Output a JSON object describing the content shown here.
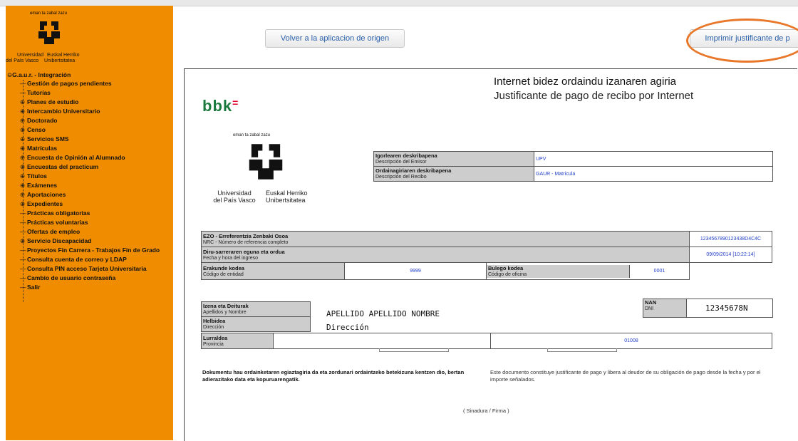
{
  "sidebar": {
    "logo_motto": "eman ta zabal zazu",
    "logo_univ_es": "Universidad\ndel País Vasco",
    "logo_univ_eu": "Euskal Herriko\nUnibertsitatea",
    "root": "G.a.u.r. - Integración",
    "items": [
      {
        "prefix": "—",
        "label": "Gestión de pagos pendientes"
      },
      {
        "prefix": "—",
        "label": "Tutorías"
      },
      {
        "prefix": "⊕",
        "label": "Planes de estudio"
      },
      {
        "prefix": "⊕",
        "label": "Intercambio Universitario"
      },
      {
        "prefix": "⊕",
        "label": "Doctorado"
      },
      {
        "prefix": "⊕",
        "label": "Censo"
      },
      {
        "prefix": "⊕",
        "label": "Servicios SMS"
      },
      {
        "prefix": "⊕",
        "label": "Matrículas"
      },
      {
        "prefix": "⊕",
        "label": "Encuesta de Opinión al Alumnado"
      },
      {
        "prefix": "⊕",
        "label": "Encuestas del practicum"
      },
      {
        "prefix": "⊕",
        "label": "Títulos"
      },
      {
        "prefix": "⊕",
        "label": "Exámenes"
      },
      {
        "prefix": "⊕",
        "label": "Aportaciones"
      },
      {
        "prefix": "⊕",
        "label": "Expedientes"
      },
      {
        "prefix": "—",
        "label": "Prácticas obligatorias"
      },
      {
        "prefix": "—",
        "label": "Prácticas voluntarias"
      },
      {
        "prefix": "—",
        "label": "Ofertas de empleo"
      },
      {
        "prefix": "⊕",
        "label": "Servicio Discapacidad"
      },
      {
        "prefix": "—",
        "label": "Proyectos Fin Carrera - Trabajos Fin de Grado"
      },
      {
        "prefix": "—",
        "label": "Consulta cuenta de correo y LDAP"
      },
      {
        "prefix": "—",
        "label": "Consulta PIN acceso Tarjeta Universitaria"
      },
      {
        "prefix": "—",
        "label": "Cambio de usuario contraseña"
      },
      {
        "prefix": "—",
        "label": "Salir"
      }
    ]
  },
  "toolbar": {
    "back_label": "Volver a la aplicacion de origen",
    "print_label": "Imprimir justificante de p"
  },
  "doc": {
    "bank": "bbk",
    "title_eu": "Internet bidez ordaindu izanaren agiria",
    "title_es": "Justificante de pago de recibo por Internet",
    "logo_motto": "eman ta zabal zazu",
    "logo_univ_es": "Universidad\ndel País Vasco",
    "logo_univ_eu": "Euskal Herriko\nUnibertsitatea",
    "emisor_eu": "Igorlearen deskribapena",
    "emisor_es": "Descripción del Emisor",
    "emisor_val": "UPV",
    "recibo_eu": "Ordainagiriaren deskribapena",
    "recibo_es": "Descripción del Recibo",
    "recibo_val": "GAUR - Matrícula",
    "nrc_eu": "EZO - Erreferentzia Zenbaki Osoa",
    "nrc_es": "NRC - Número de referencia completo",
    "nrc_val": "1234567890123438​D4C4C",
    "fecha_eu": "Diru-sarreraren eguna eta ordua",
    "fecha_es": "Fecha y hora del ingreso",
    "fecha_val": "09/09/2014 [10:22:14]",
    "entidad_eu": "Erakunde kodea",
    "entidad_es": "Código de entidad",
    "entidad_val": "9999",
    "oficina_eu": "Bulego kodea",
    "oficina_es": "Código de oficina",
    "oficina_val": "0001",
    "nombre_eu": "Izena eta Deiturak",
    "nombre_es": "Apellidos y Nombre",
    "nombre_val": "APELLIDO APELLIDO NOMBRE",
    "dir_eu": "Helbidea",
    "dir_es": "Dirección",
    "dir_val": "Dirección",
    "prov_eu": "Lurraldea",
    "prov_es": "Provincia",
    "cp_val": "01008",
    "dni_eu": "NAN",
    "dni_es": "DNI",
    "dni_val": "12345678N",
    "note_eu": "Dokumentu hau ordainketaren egiaztagiria da eta zordunari ordaintzeko betekizuna kentzen dio, bertan adierazitako data eta kopuruarengatik.",
    "note_es": "Este documento constituye justificante de pago y libera al deudor de su obligación de pago desde la fecha y por el importe señalados.",
    "signature": "( Sinadura / Firma )"
  }
}
